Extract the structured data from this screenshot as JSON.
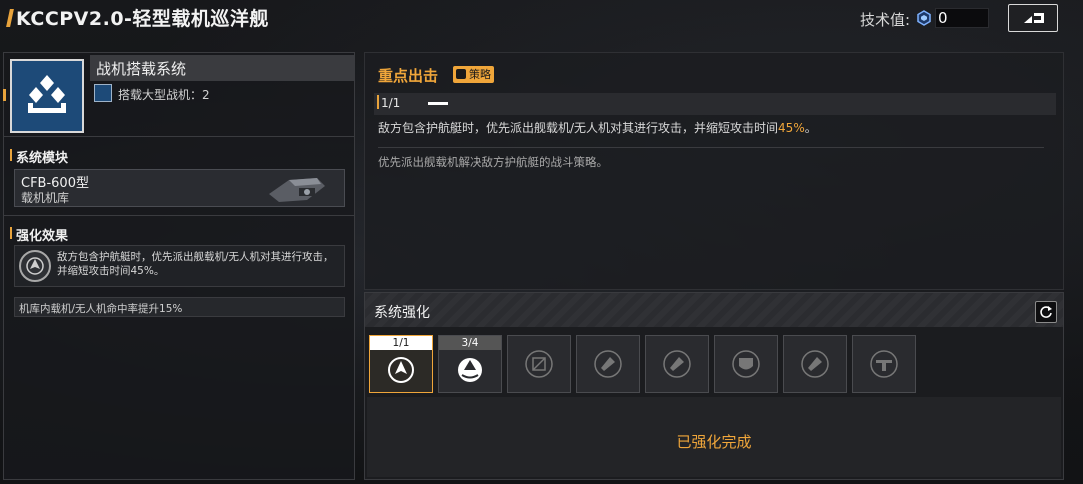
{
  "header": {
    "title": "KCCPV2.0-轻型载机巡洋舰",
    "tech_label": "技术值:",
    "tech_value": "0"
  },
  "system": {
    "name": "战机搭载系统",
    "carrier_text": "搭载大型战机：2"
  },
  "modules": {
    "section_label": "系统模块",
    "name": "CFB-600型",
    "type": "载机机库"
  },
  "effects": {
    "section_label": "强化效果",
    "main_text": "敌方包含护航艇时，优先派出舰载机/无人机对其进行攻击，并缩短攻击时间45%。",
    "bonus_text": "机库内载机/无人机命中率提升15%"
  },
  "focus": {
    "title": "重点出击",
    "badge": "策略",
    "level": "1/1",
    "desc_prefix": "敌方包含护航艇时，优先派出舰载机/无人机对其进行攻击，并缩短攻击时间",
    "desc_highlight": "45%",
    "desc_suffix": "。",
    "sub_desc": "优先派出舰载机解决敌方护航艇的战斗策略。",
    "highlight_color": "#f0a63a"
  },
  "enhance": {
    "title": "系统强化",
    "slots": [
      {
        "count": "1/1",
        "icon": "aircraft-target-icon",
        "state": "active"
      },
      {
        "count": "3/4",
        "icon": "radar-dome-icon",
        "state": "partial"
      },
      {
        "count": "",
        "icon": "locked-module-icon",
        "state": "locked"
      },
      {
        "count": "",
        "icon": "locked-aircraft-icon",
        "state": "locked"
      },
      {
        "count": "",
        "icon": "locked-aircraft-icon",
        "state": "locked"
      },
      {
        "count": "",
        "icon": "locked-shield-icon",
        "state": "locked"
      },
      {
        "count": "",
        "icon": "locked-aircraft-icon",
        "state": "locked"
      },
      {
        "count": "",
        "icon": "locked-drone-icon",
        "state": "locked"
      }
    ],
    "done_text": "已强化完成"
  },
  "colors": {
    "accent": "#f0a63a",
    "system_blue": "#1d4a78"
  }
}
